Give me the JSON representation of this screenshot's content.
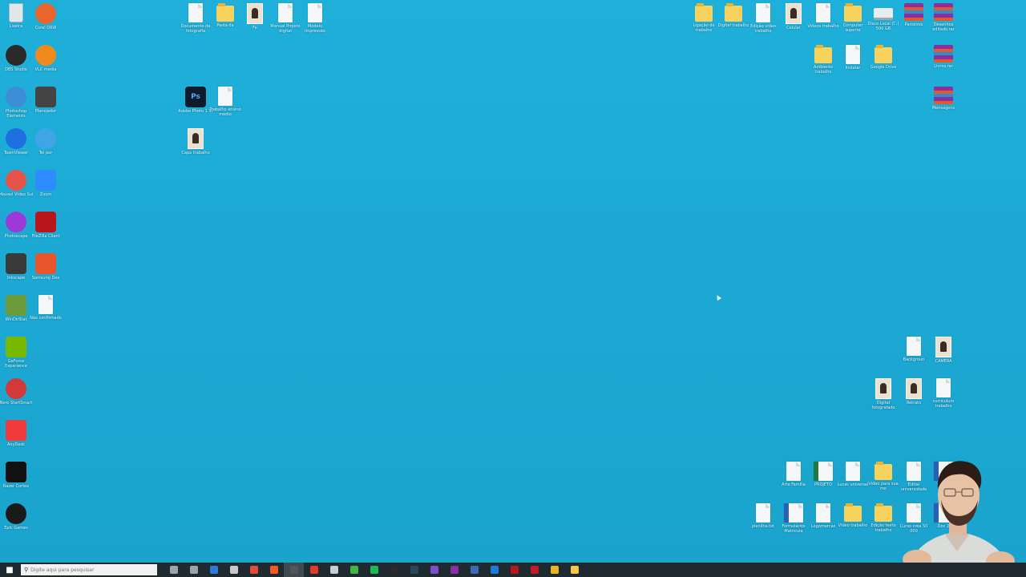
{
  "desktop": {
    "background_color": "#1ba8d2",
    "left_column_icons": [
      {
        "label": "Lixeira",
        "icon": "recycle-bin-icon",
        "color": "#dfe7ea"
      },
      {
        "label": "Corel DRW",
        "icon": "corel-icon",
        "color": "#e8662b"
      },
      {
        "label": "OBS Studio",
        "icon": "obs-icon",
        "color": "#2a2a2a"
      },
      {
        "label": "VLC media",
        "icon": "vlc-icon",
        "color": "#f08a1c"
      },
      {
        "label": "Photoshop Elements",
        "icon": "photoshop-elements-icon",
        "color": "#3c8fd6"
      },
      {
        "label": "Planejador",
        "icon": "planner-icon",
        "color": "#444444"
      },
      {
        "label": "TeamViewer",
        "icon": "teamviewer-icon",
        "color": "#1e6fe0"
      },
      {
        "label": "Tel per",
        "icon": "phone-icon",
        "color": "#3fa5e6"
      },
      {
        "label": "Movavi Video Sui",
        "icon": "movavi-icon",
        "color": "#e5534b"
      },
      {
        "label": "Zoom",
        "icon": "zoom-icon",
        "color": "#2d8cff"
      },
      {
        "label": "Photoscape",
        "icon": "photoscape-icon",
        "color": "#9c3ad8"
      },
      {
        "label": "FileZilla Client",
        "icon": "filezilla-icon",
        "color": "#b7161b"
      },
      {
        "label": "Inkscape",
        "icon": "inkscape-icon",
        "color": "#3a3a3a"
      },
      {
        "label": "Samsung Dex",
        "icon": "samsung-dex-icon",
        "color": "#e8552b"
      },
      {
        "label": "WinDirStat",
        "icon": "windirstat-icon",
        "color": "#6d9b3b"
      },
      {
        "label": "Não confirmado",
        "icon": "file-icon",
        "color": "#f4f6f7"
      },
      {
        "label": "GeForce Experience",
        "icon": "geforce-icon",
        "color": "#76b900"
      },
      {
        "label": "Nero StartSmart",
        "icon": "nero-icon",
        "color": "#d23a3a"
      },
      {
        "label": "AnyDesk",
        "icon": "anydesk-icon",
        "color": "#ef3b3b"
      },
      {
        "label": "Razer Cortex",
        "icon": "razer-icon",
        "color": "#111111"
      },
      {
        "label": "Epic Games",
        "icon": "epic-icon",
        "color": "#1a1a1a"
      }
    ],
    "center_icons": [
      {
        "label": "Documento de fotografia",
        "icon": "document-icon"
      },
      {
        "label": "Pasta da",
        "icon": "folder-icon"
      },
      {
        "label": "Fe",
        "icon": "photo-file-icon"
      },
      {
        "label": "Manual Projeto digital",
        "icon": "document-icon"
      },
      {
        "label": "Modelo impressão",
        "icon": "document-icon"
      },
      {
        "label": "Adobe Photo 1 St",
        "icon": "photoshop-file-icon"
      },
      {
        "label": "Trabalho ensino médio",
        "icon": "document-icon"
      },
      {
        "label": "Capa trabalho",
        "icon": "photo-file-icon"
      }
    ],
    "right_top_icons": [
      {
        "label": "Ligação de trabalho",
        "icon": "folder-icon"
      },
      {
        "label": "Digital trabalho",
        "icon": "folder-icon"
      },
      {
        "label": "Edição vídeo trabalho",
        "icon": "document-icon"
      },
      {
        "label": "Celular",
        "icon": "phone-file-icon"
      },
      {
        "label": "Vídeos trabalho",
        "icon": "document-icon"
      },
      {
        "label": "Computer suporte",
        "icon": "folder-icon"
      },
      {
        "label": "Disco Local (C:) 500 GB",
        "icon": "drive-icon"
      },
      {
        "label": "Parceiros",
        "icon": "winrar-icon"
      },
      {
        "label": "Desenhos editado.rar",
        "icon": "winrar-icon"
      },
      {
        "label": "Ambiente trabalho",
        "icon": "folder-icon"
      },
      {
        "label": "Instalar",
        "icon": "document-icon"
      },
      {
        "label": "Google Drive",
        "icon": "folder-icon"
      },
      {
        "label": "Livros.rar",
        "icon": "winrar-icon"
      },
      {
        "label": "Mensagens",
        "icon": "winrar-icon"
      }
    ],
    "right_middle_icons": [
      {
        "label": "Backgroun",
        "icon": "document-icon"
      },
      {
        "label": "CAMERA",
        "icon": "photo-file-icon"
      },
      {
        "label": "Digital fotografado",
        "icon": "photo-file-icon"
      },
      {
        "label": "Retrato",
        "icon": "photo-file-icon"
      },
      {
        "label": "curriculum trabalho",
        "icon": "document-icon"
      }
    ],
    "right_bottom_icons": [
      {
        "label": "Arte Família",
        "icon": "document-icon"
      },
      {
        "label": "PROJETO",
        "icon": "excel-icon"
      },
      {
        "label": "Lucas universal",
        "icon": "document-icon"
      },
      {
        "label": "Vídeo para sua mo",
        "icon": "folder-icon"
      },
      {
        "label": "Edital universidade",
        "icon": "document-icon"
      },
      {
        "label": "Doc",
        "icon": "word-icon"
      },
      {
        "label": "planilha.txt",
        "icon": "document-icon"
      },
      {
        "label": "Formulários Matrícula",
        "icon": "word-icon"
      },
      {
        "label": "Logomarcas",
        "icon": "document-icon"
      },
      {
        "label": "Vídeo trabalho",
        "icon": "folder-icon"
      },
      {
        "label": "Edição texto trabalho",
        "icon": "folder-icon"
      },
      {
        "label": "Curso crea 50 000",
        "icon": "document-icon"
      },
      {
        "label": "Doc 2",
        "icon": "word-icon"
      }
    ]
  },
  "taskbar": {
    "search_placeholder": "Digite aqui para pesquisar",
    "apps": [
      {
        "name": "task-view",
        "color": "#9aa5aa"
      },
      {
        "name": "cortana",
        "color": "#9aa5aa"
      },
      {
        "name": "edge",
        "color": "#2d7bd6"
      },
      {
        "name": "microphone",
        "color": "#c9c9c9"
      },
      {
        "name": "store",
        "color": "#e34b3f"
      },
      {
        "name": "brave",
        "color": "#f05b24"
      },
      {
        "name": "obs",
        "color": "#555555"
      },
      {
        "name": "opera",
        "color": "#e23b2e"
      },
      {
        "name": "mail",
        "color": "#c7ced2"
      },
      {
        "name": "camtasia",
        "color": "#3fb549"
      },
      {
        "name": "spotify",
        "color": "#1db954"
      },
      {
        "name": "terminal",
        "color": "#2a2a2a"
      },
      {
        "name": "steam",
        "color": "#2a475e"
      },
      {
        "name": "visual-studio",
        "color": "#7d4fc4"
      },
      {
        "name": "onenote",
        "color": "#8e2da0"
      },
      {
        "name": "remote-desktop",
        "color": "#3a6bb3"
      },
      {
        "name": "vs-code",
        "color": "#1f7ad6"
      },
      {
        "name": "filezilla",
        "color": "#b7161b"
      },
      {
        "name": "adobe",
        "color": "#c11c2b"
      },
      {
        "name": "chrome",
        "color": "#e8b523"
      },
      {
        "name": "files",
        "color": "#f1c84b"
      }
    ]
  }
}
